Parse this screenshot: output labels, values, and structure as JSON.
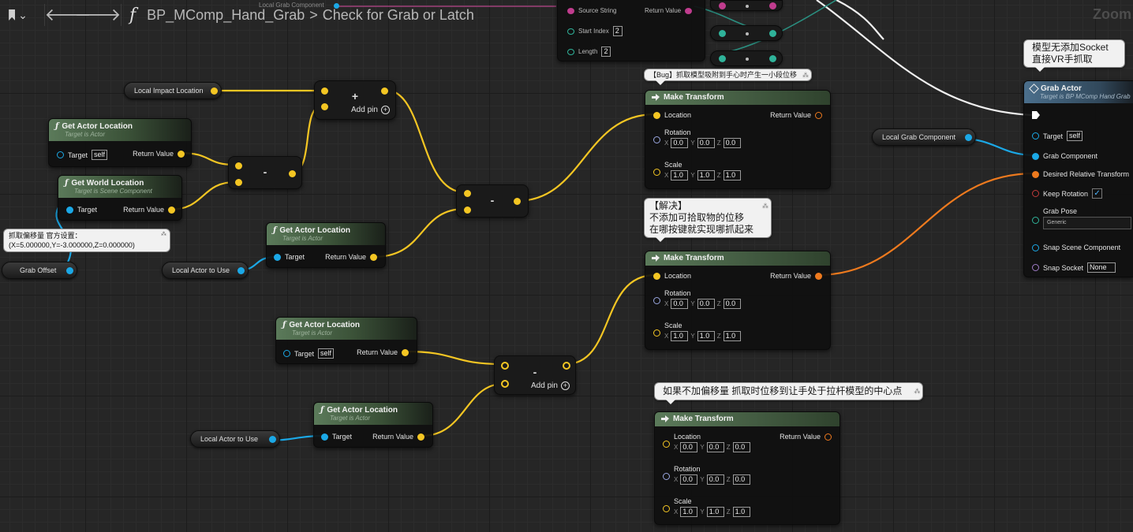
{
  "header": {
    "function_name": "BP_MComp_Hand_Grab",
    "graph_name": "Check for Grab or Latch",
    "separator": ">",
    "zoom_label": "Zoom",
    "fn_glyph": "f"
  },
  "colors": {
    "vector_pin": "#f4c623",
    "object_pin": "#1ba8e6",
    "transform_pin": "#ee7a1e",
    "function_header": "#5b7a5a",
    "exec_wire": "#ffffff"
  },
  "top_node": {
    "title": "Local Grab Component",
    "source_string": "Source String",
    "return_value": "Return Value",
    "start_index_label": "Start Index",
    "start_index": "2",
    "length_label": "Length",
    "length": "2"
  },
  "pills": {
    "local_impact_location": "Local Impact Location",
    "grab_offset": "Grab Offset",
    "local_actor_to_use_1": "Local Actor to Use",
    "local_actor_to_use_2": "Local Actor to Use",
    "local_grab_component": "Local Grab Component"
  },
  "comments": {
    "grab_offset_note_line1": "抓取偏移量 官方设置：",
    "grab_offset_note_line2": "(X=5.000000,Y=-3.000000,Z=0.000000)",
    "bug_note": "【Bug】抓取模型吸附到手心时产生一小段位移",
    "fix_line1": "【解决】",
    "fix_line2": "不添加可拾取物的位移",
    "fix_line3": "在哪按键就实现哪抓起来",
    "no_offset_note": "如果不加偏移量 抓取时位移到让手处于拉杆模型的中心点",
    "socket_line1": "模型无添加Socket",
    "socket_line2": "直接VR手抓取"
  },
  "get_actor_location_1": {
    "title": "Get Actor Location",
    "subtitle": "Target is Actor",
    "target_label": "Target",
    "target_value": "self",
    "return_label": "Return Value"
  },
  "get_world_location": {
    "title": "Get World Location",
    "subtitle": "Target is Scene Component",
    "target_label": "Target",
    "return_label": "Return Value"
  },
  "get_actor_location_2": {
    "title": "Get Actor Location",
    "subtitle": "Target is Actor",
    "target_label": "Target",
    "return_label": "Return Value"
  },
  "get_actor_location_3": {
    "title": "Get Actor Location",
    "subtitle": "Target is Actor",
    "target_label": "Target",
    "target_value": "self",
    "return_label": "Return Value"
  },
  "get_actor_location_4": {
    "title": "Get Actor Location",
    "subtitle": "Target is Actor",
    "target_label": "Target",
    "return_label": "Return Value"
  },
  "ops": {
    "add_symbol": "+",
    "minus_symbol": "-",
    "add_pin_label": "Add pin"
  },
  "make_transform_1": {
    "title": "Make Transform",
    "location_label": "Location",
    "return_label": "Return Value",
    "rotation_label": "Rotation",
    "rotation": [
      "0.0",
      "0.0",
      "0.0"
    ],
    "scale_label": "Scale",
    "scale": [
      "1.0",
      "1.0",
      "1.0"
    ]
  },
  "make_transform_2": {
    "title": "Make Transform",
    "location_label": "Location",
    "return_label": "Return Value",
    "rotation_label": "Rotation",
    "rotation": [
      "0.0",
      "0.0",
      "0.0"
    ],
    "scale_label": "Scale",
    "scale": [
      "1.0",
      "1.0",
      "1.0"
    ]
  },
  "make_transform_3": {
    "title": "Make Transform",
    "location_label": "Location",
    "return_label": "Return Value",
    "location": [
      "0.0",
      "0.0",
      "0.0"
    ],
    "rotation_label": "Rotation",
    "rotation": [
      "0.0",
      "0.0",
      "0.0"
    ],
    "scale_label": "Scale",
    "scale": [
      "1.0",
      "1.0",
      "1.0"
    ]
  },
  "axis": {
    "x": "X",
    "y": "Y",
    "z": "Z"
  },
  "grab_actor": {
    "title": "Grab Actor",
    "subtitle": "Target is BP MComp Hand Grab",
    "target_label": "Target",
    "target_value": "self",
    "grab_component_label": "Grab Component",
    "desired_relative_transform_label": "Desired Relative Transform",
    "keep_rotation_label": "Keep Rotation",
    "keep_rotation_checked": "✓",
    "grab_pose_label": "Grab Pose",
    "grab_pose_value": "Generic",
    "snap_scene_component_label": "Snap Scene Component",
    "snap_socket_label": "Snap Socket",
    "snap_socket_value": "None"
  }
}
